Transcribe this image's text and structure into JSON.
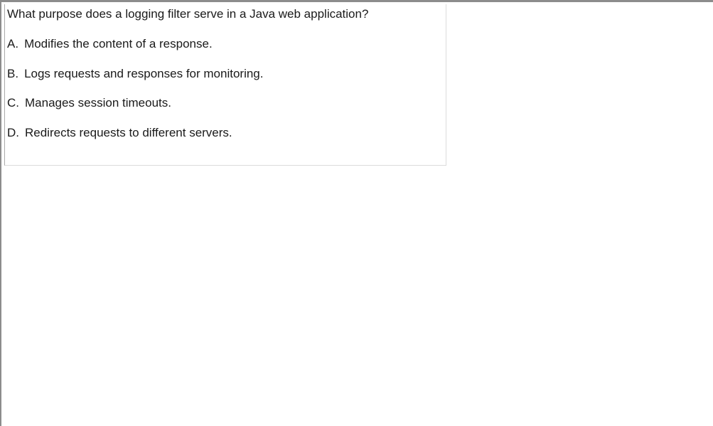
{
  "question": {
    "text": "What purpose does a logging filter serve in a Java web application?"
  },
  "options": [
    {
      "letter": "A.",
      "text": "Modifies the content of a response."
    },
    {
      "letter": "B.",
      "text": "Logs requests and responses for monitoring."
    },
    {
      "letter": "C.",
      "text": "Manages session timeouts."
    },
    {
      "letter": "D.",
      "text": "Redirects requests to different servers."
    }
  ]
}
